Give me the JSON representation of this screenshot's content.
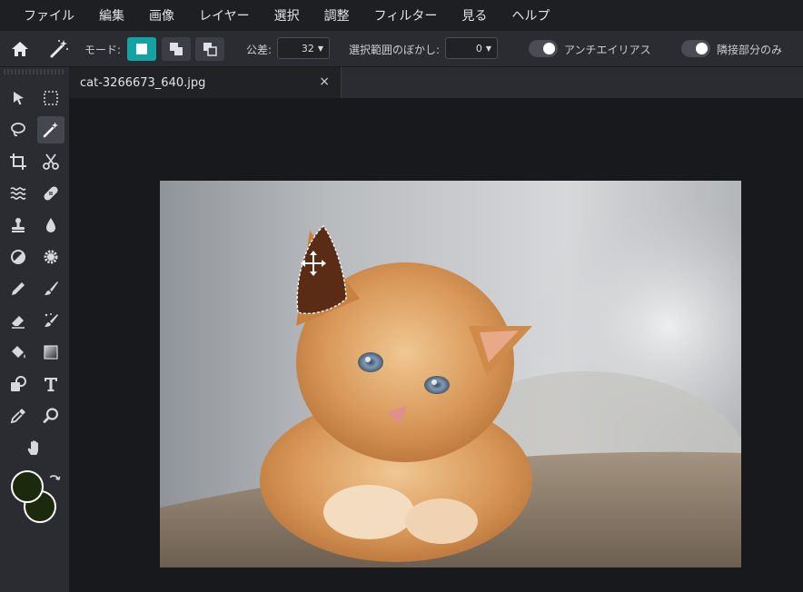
{
  "menu": [
    "ファイル",
    "編集",
    "画像",
    "レイヤー",
    "選択",
    "調整",
    "フィルター",
    "見る",
    "ヘルプ"
  ],
  "options": {
    "mode_label": "モード:",
    "tolerance_label": "公差:",
    "tolerance_value": "32",
    "feather_label": "選択範囲のぼかし:",
    "feather_value": "0",
    "antialias_label": "アンチエイリアス",
    "contiguous_label": "隣接部分のみ"
  },
  "tab": {
    "title": "cat-3266673_640.jpg",
    "close": "×"
  },
  "colors": {
    "accent": "#14a3a3",
    "foreground": "#1b2a0c",
    "background": "#1b2a0c"
  }
}
